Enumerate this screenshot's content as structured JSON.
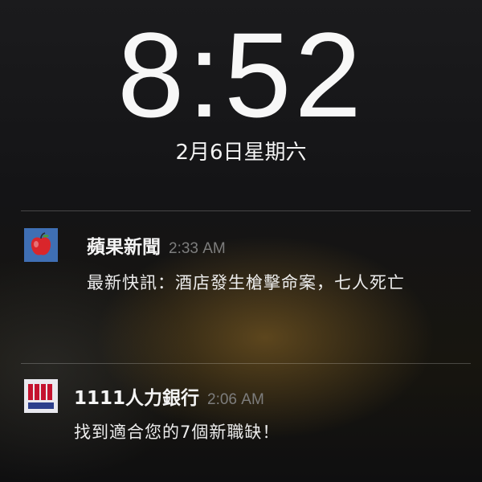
{
  "lock_screen": {
    "clock": "8:52",
    "date": "2月6日星期六"
  },
  "notifications": [
    {
      "icon": "apple-daily-icon",
      "app_name": "蘋果新聞",
      "time": "2:33 AM",
      "message": "最新快訊：酒店發生槍擊命案，七人死亡"
    },
    {
      "icon": "1111-job-bank-icon",
      "app_name": "1111人力銀行",
      "time": "2:06 AM",
      "message": "找到適合您的7個新職缺！"
    }
  ],
  "colors": {
    "text": "#f4f4f4",
    "time_text": "#7d7d7d",
    "apple_icon_bg": "#3f6fb4",
    "job_icon_bg": "#e9e9ef",
    "job_icon_accent": "#c4122f"
  }
}
